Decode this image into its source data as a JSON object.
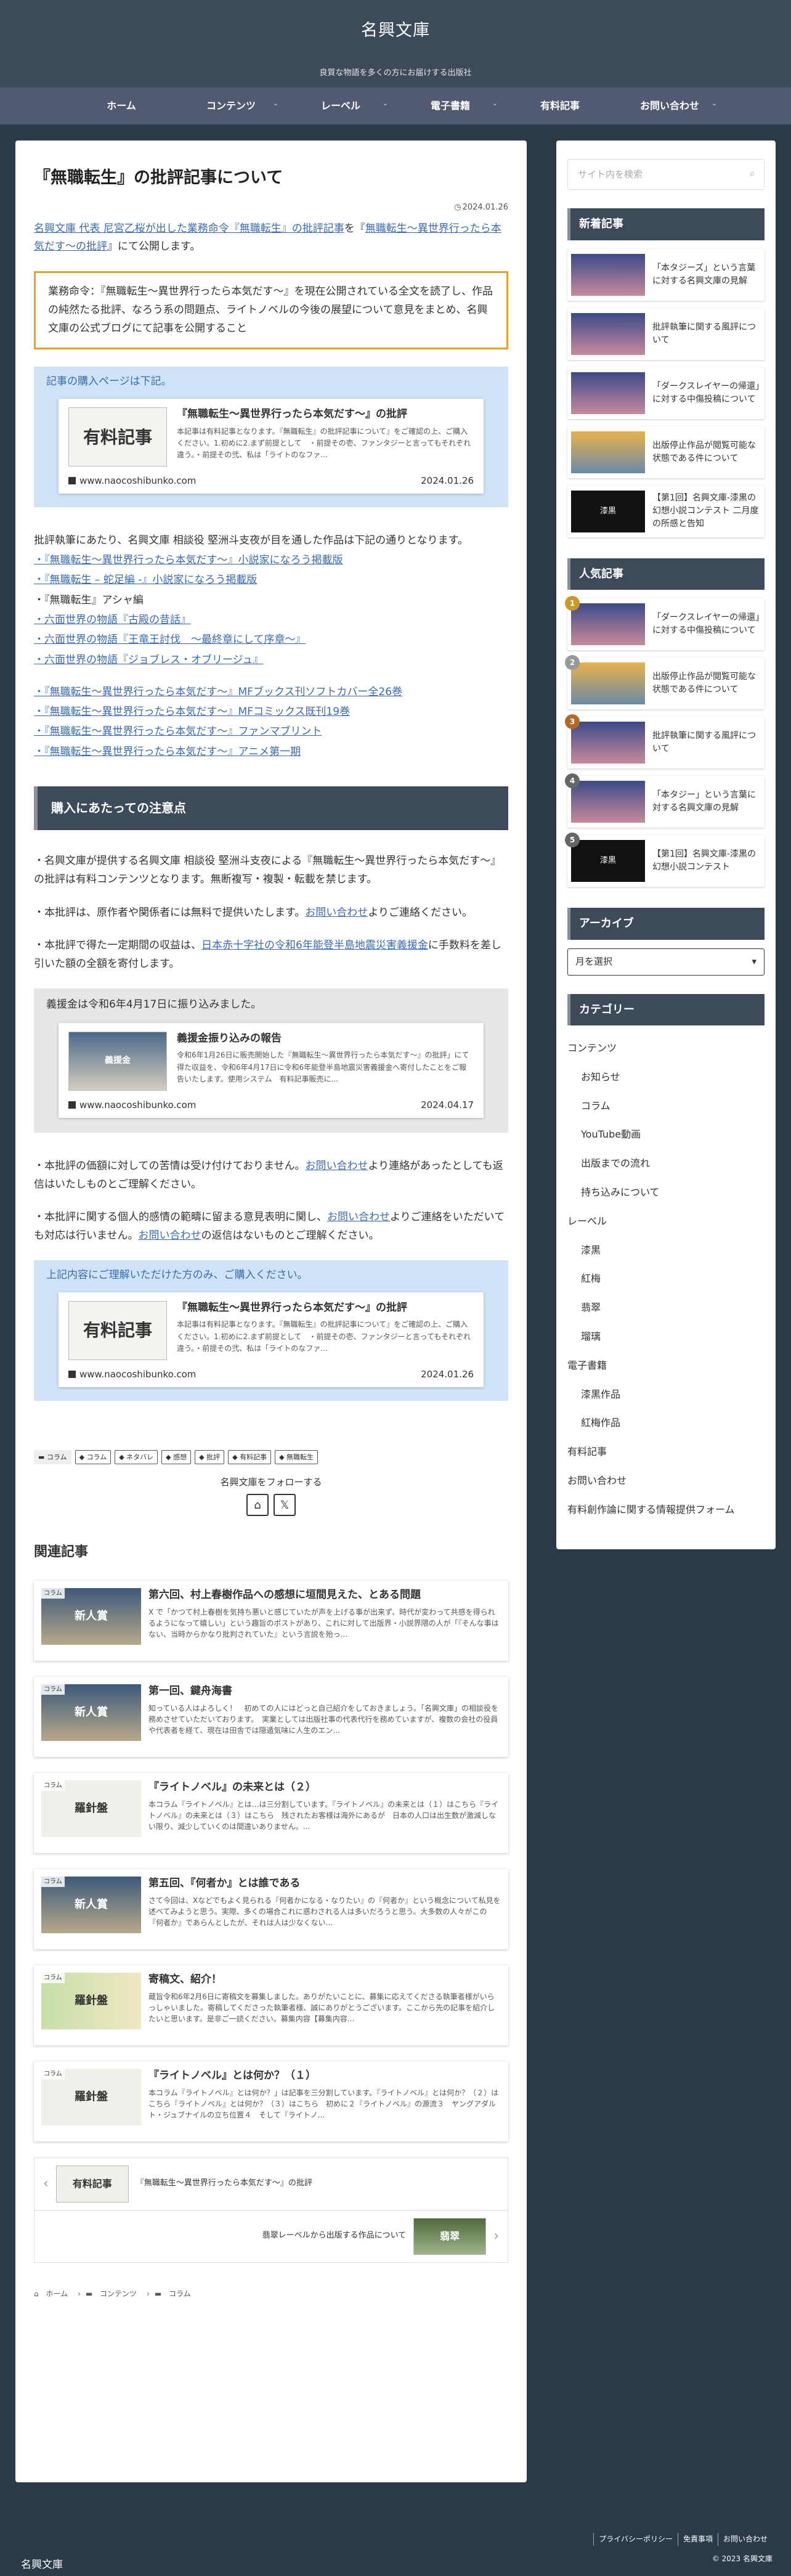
{
  "site": {
    "title": "名興文庫",
    "tagline": "良質な物語を多くの方にお届けする出版社"
  },
  "nav": [
    {
      "label": "ホーム",
      "caret": false
    },
    {
      "label": "コンテンツ",
      "caret": true
    },
    {
      "label": "レーベル",
      "caret": true
    },
    {
      "label": "電子書籍",
      "caret": true
    },
    {
      "label": "有料記事",
      "caret": false
    },
    {
      "label": "お問い合わせ",
      "caret": true
    }
  ],
  "article": {
    "title": "『無職転生』の批評記事について",
    "date": "2024.01.26",
    "intro_link": "名興文庫 代表 尼宮乙桜が出した業務命令『無職転生』の批評記事",
    "intro_mid": "を『",
    "intro_link2": "無職転生〜異世界行ったら本気だす〜の批評",
    "intro_end": "』にて公開します。",
    "orange_box": "業務命令：『無職転生〜異世界行ったら本気だす〜』を現在公開されている全文を読了し、作品の純然たる批評、なろう系の問題点、ライトノベルの今後の展望について意見をまとめ、名興文庫の公式ブログにて記事を公開すること",
    "blue_lead": "記事の購入ページは下記。",
    "card1": {
      "thumb": "有料記事",
      "title": "『無職転生〜異世界行ったら本気だす〜』の批評",
      "desc": "本記事は有料記事となります。『無職転生』の批評記事について』をご確認の上、ご購入ください。1.初めに2.まず前提として　・前提その壱、ファンタジーと言ってもそれぞれ違う。・前提その弐、私は「ライトのなファ...",
      "domain": "www.naocoshibunko.com",
      "date": "2024.01.26"
    },
    "body_lead": "批評執筆にあたり、名興文庫 相談役 堅洲斗支夜が目を通した作品は下記の通りとなります。",
    "works_a": [
      "・『無職転生〜異世界行ったら本気だす〜』小説家になろう掲載版",
      "・『無職転生 – 蛇足編 -』小説家になろう掲載版",
      "・『無職転生』アシャ編",
      "・六面世界の物語『古殿の昔話』",
      "・六面世界の物語『王竜王討伐　～最終章にして序章～』",
      "・六面世界の物語『ジョブレス・オブリージュ』"
    ],
    "works_b": [
      "・『無職転生〜異世界行ったら本気だす〜』MFブックス刊ソフトカバー全26巻",
      "・『無職転生〜異世界行ったら本気だす〜』MFコミックス既刊19巻",
      "・『無職転生〜異世界行ったら本気だす〜』ファンマブリント",
      "・『無職転生〜異世界行ったら本気だす〜』アニメ第一期"
    ],
    "heading": "購入にあたっての注意点",
    "note1": "・名興文庫が提供する名興文庫 相談役 堅洲斗支夜による『無職転生〜異世界行ったら本気だす〜』の批評は有料コンテンツとなります。無断複写・複製・転載を禁じます。",
    "note2_pre": "・本批評は、原作者や関係者には無料で提供いたします。",
    "note2_link": "お問い合わせ",
    "note2_post": "よりご連絡ください。",
    "note3_pre": "・本批評で得た一定期間の収益は、",
    "note3_link": "日本赤十字社の令和6年能登半島地震災害義援金",
    "note3_post": "に手数料を差し引いた額の全額を寄付します。",
    "gray_lead": "義援金は令和6年4月17日に振り込みました。",
    "card2": {
      "thumb": "義援金",
      "title": "義援金振り込みの報告",
      "desc": "令和6年1月26日に販売開始した『無職転生〜異世界行ったら本気だす〜』の批評」にて得た収益を、令和6年4月17日に令和6年能登半島地震災害義援金へ寄付したことをご報告いたします。使用システム　有料記事販売に...",
      "domain": "www.naocoshibunko.com",
      "date": "2024.04.17"
    },
    "note4_pre": "・本批評の価額に対しての苦情は受け付けておりません。",
    "note4_link": "お問い合わせ",
    "note4_post": "より連絡があったとしても返信はいたしものとご理解ください。",
    "note5_pre": "・本批評に関する個人的感情の範疇に留まる意見表明に関し、",
    "note5_link": "お問い合わせ",
    "note5_mid": "よりご連絡をいただいても対応は行いません。",
    "note5_link2": "お問い合わせ",
    "note5_post": "の返信はないものとご理解ください。",
    "blue2_lead": "上記内容にご理解いただけた方のみ、ご購入ください。",
    "card3": {
      "thumb": "有料記事",
      "title": "『無職転生〜異世界行ったら本気だす〜』の批評",
      "desc": "本記事は有料記事となります。『無職転生』の批評記事について』をご確認の上、ご購入ください。1.初めに2.まず前提として　・前提その壱、ファンタジーと言ってもそれぞれ違う。・前提その弐、私は「ライトのなファ...",
      "domain": "www.naocoshibunko.com",
      "date": "2024.01.26"
    },
    "tags": [
      "コラム",
      "コラム",
      "ネタバレ",
      "感想",
      "批評",
      "有料記事",
      "無職転生"
    ],
    "follow": "名興文庫をフォローする"
  },
  "related": {
    "title": "関連記事",
    "items": [
      {
        "cat": "コラム",
        "thumb": "新人賞",
        "style": "",
        "title": "第六回、村上春樹作品への感想に垣間見えた、とある問題",
        "desc": "X で「かつて村上春樹を気持ち悪いと感じていたが声を上げる事が出来ず、時代が変わって共感を得られるようになって嬉しい」という趣旨のポストがあり、これに対して出版界・小説界隈の人が「『そんな事はない、当時からかなり批判されていた』という言説を殆っ..."
      },
      {
        "cat": "コラム",
        "thumb": "新人賞",
        "style": "",
        "title": "第一回、鍵舟海書",
        "desc": "知っている人はよろしく！　初めての人にはどっと自己紹介をしておきましょう。「名興文庫」の相談役を務めさせていただいております。　実業としては出版社事の代表代行を務めていますが、複数の会社の役員や代表者を経て、現在は田舎では隠遁気味に人生のエン..."
      },
      {
        "cat": "コラム",
        "thumb": "羅針盤",
        "style": "w",
        "title": "『ライトノベル』の未来とは（２）",
        "desc": "本コラム『ライトノベル』とは…は三分割しています。『ライトノベル』の未来とは（１）はこちら『ライトノベル』の未来とは（３）はこちら　残されたお客様は海外にあるが　日本の人口は出生数が激減しない限り、減少していくのは間違いありません。..."
      },
      {
        "cat": "コラム",
        "thumb": "新人賞",
        "style": "",
        "title": "第五回、『何者か』とは誰である",
        "desc": "さて今回は、Xなどでもよく見られる『何者かになる・なりたい』の『何者か』という概念について私見を述べてみようと思う。実際、多くの場合これに惑わされる人は多いだろうと思う。大多数の人々がこの『何者か』であらんとしたが、それは人は少なくない..."
      },
      {
        "cat": "コラム",
        "thumb": "羅針盤",
        "style": "w2",
        "title": "寄稿文、紹介！",
        "desc": "蔵旨令和6年2月6日に寄稿文を募集しました。ありがたいことに、募集に応えてくださる執筆者様がいらっしゃいました。寄稿してくださった執筆者様、誠にありがとうございます。ここから先の記事を紹介したいと思います。是非ご一読ください。募集内容【募集内容..."
      },
      {
        "cat": "コラム",
        "thumb": "羅針盤",
        "style": "w",
        "title": "『ライトノベル』とは何か？（１）",
        "desc": "本コラム『ライトノベル』とは何か？」は記事を三分割しています。『ライトノベル』とは何か？（２）はこちら『ライトノベル』とは何か？（３）はこちら　初めに２『ライトノベル』の源流３　ヤングアダルト・ジュブナイルの立ち位置４　そして『ライトノ..."
      }
    ]
  },
  "pager": {
    "prev_label": "『無職転生〜異世界行ったら本気だす〜』の批評",
    "prev_thumb": "有料記事",
    "next_label": "翡翠レーベルから出版する作品について",
    "next_thumb": "翡翠"
  },
  "breadcrumb": [
    "ホーム",
    "コンテンツ",
    "コラム"
  ],
  "sidebar": {
    "search_placeholder": "サイト内を検索",
    "new_title": "新着記事",
    "new_items": [
      {
        "label": "「本タジーズ」という言葉に対する名興文庫の見解",
        "thumb": ""
      },
      {
        "label": "批評執筆に関する風評について",
        "thumb": ""
      },
      {
        "label": "「ダークスレイヤーの帰還」に対する中傷投稿について",
        "thumb": ""
      },
      {
        "label": "出版停止作品が閲覧可能な状態である件について",
        "thumb": "gold"
      },
      {
        "label": "【第1回】名興文庫-漆黒の幻想小説コンテスト 二月度の所感と告知",
        "thumb": "blk"
      }
    ],
    "popular_title": "人気記事",
    "popular_items": [
      {
        "rank": "1",
        "label": "「ダークスレイヤーの帰還」に対する中傷投稿について",
        "thumb": ""
      },
      {
        "rank": "2",
        "label": "出版停止作品が閲覧可能な状態である件について",
        "thumb": "gold"
      },
      {
        "rank": "3",
        "label": "批評執筆に関する風評について",
        "thumb": ""
      },
      {
        "rank": "4",
        "label": "「本タジー」という言葉に対する名興文庫の見解",
        "thumb": ""
      },
      {
        "rank": "5",
        "label": "【第1回】名興文庫-漆黒の幻想小説コンテスト",
        "thumb": "blk"
      }
    ],
    "blk_thumb_text": "漆黒",
    "archive_title": "アーカイブ",
    "archive_select": "月を選択",
    "category_title": "カテゴリー",
    "categories": [
      {
        "label": "コンテンツ",
        "sub": false
      },
      {
        "label": "お知らせ",
        "sub": true
      },
      {
        "label": "コラム",
        "sub": true
      },
      {
        "label": "YouTube動画",
        "sub": true
      },
      {
        "label": "出版までの流れ",
        "sub": true
      },
      {
        "label": "持ち込みについて",
        "sub": true
      },
      {
        "label": "レーベル",
        "sub": false
      },
      {
        "label": "漆黒",
        "sub": true
      },
      {
        "label": "紅梅",
        "sub": true
      },
      {
        "label": "翡翠",
        "sub": true
      },
      {
        "label": "瑠璃",
        "sub": true
      },
      {
        "label": "電子書籍",
        "sub": false
      },
      {
        "label": "漆黒作品",
        "sub": true
      },
      {
        "label": "紅梅作品",
        "sub": true
      },
      {
        "label": "有料記事",
        "sub": false
      },
      {
        "label": "お問い合わせ",
        "sub": false
      },
      {
        "label": "有料創作論に関する情報提供フォーム",
        "sub": false
      }
    ]
  },
  "footer": {
    "links": [
      "プライバシーポリシー",
      "免責事項",
      "お問い合わせ"
    ],
    "copy": "© 2023 名興文庫",
    "logo": "名興文庫"
  }
}
